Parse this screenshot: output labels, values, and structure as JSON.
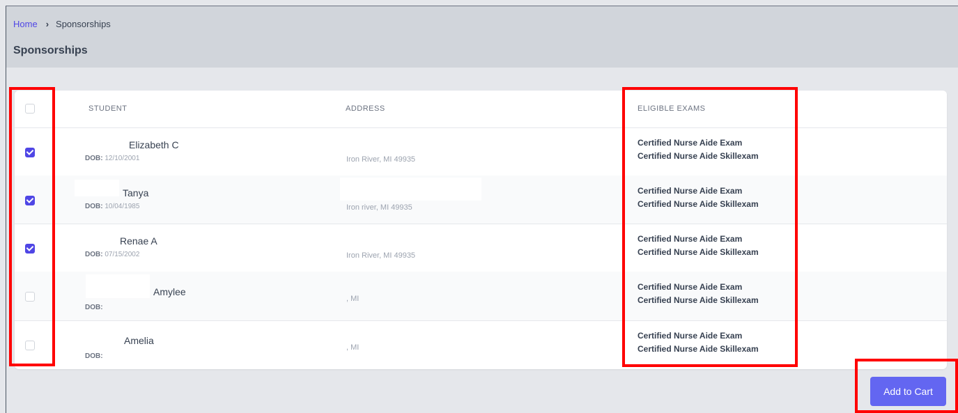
{
  "breadcrumb": {
    "home": "Home",
    "separator": "›",
    "current": "Sponsorships"
  },
  "page_title": "Sponsorships",
  "table": {
    "headers": {
      "student": "STUDENT",
      "address": "ADDRESS",
      "exams": "ELIGIBLE EXAMS"
    },
    "dob_label": "DOB:",
    "rows": [
      {
        "name": "Elizabeth C",
        "dob": "12/10/2001",
        "address": "Iron River, MI 49935",
        "checked": true,
        "exams": [
          "Certified Nurse Aide Exam",
          "Certified Nurse Aide Skillexam"
        ]
      },
      {
        "name": "Tanya",
        "dob": "10/04/1985",
        "address": "Iron river, MI 49935",
        "checked": true,
        "exams": [
          "Certified Nurse Aide Exam",
          "Certified Nurse Aide Skillexam"
        ]
      },
      {
        "name": "Renae A",
        "dob": "07/15/2002",
        "address": "Iron River, MI 49935",
        "checked": true,
        "exams": [
          "Certified Nurse Aide Exam",
          "Certified Nurse Aide Skillexam"
        ]
      },
      {
        "name": "Amylee",
        "dob": "",
        "address": ", MI",
        "checked": false,
        "exams": [
          "Certified Nurse Aide Exam",
          "Certified Nurse Aide Skillexam"
        ]
      },
      {
        "name": "Amelia",
        "dob": "",
        "address": ", MI",
        "checked": false,
        "exams": [
          "Certified Nurse Aide Exam",
          "Certified Nurse Aide Skillexam"
        ]
      }
    ]
  },
  "actions": {
    "add_to_cart": "Add to Cart"
  },
  "colors": {
    "accent": "#4f46e5",
    "button": "#6366f1",
    "highlight": "#ff0000"
  }
}
